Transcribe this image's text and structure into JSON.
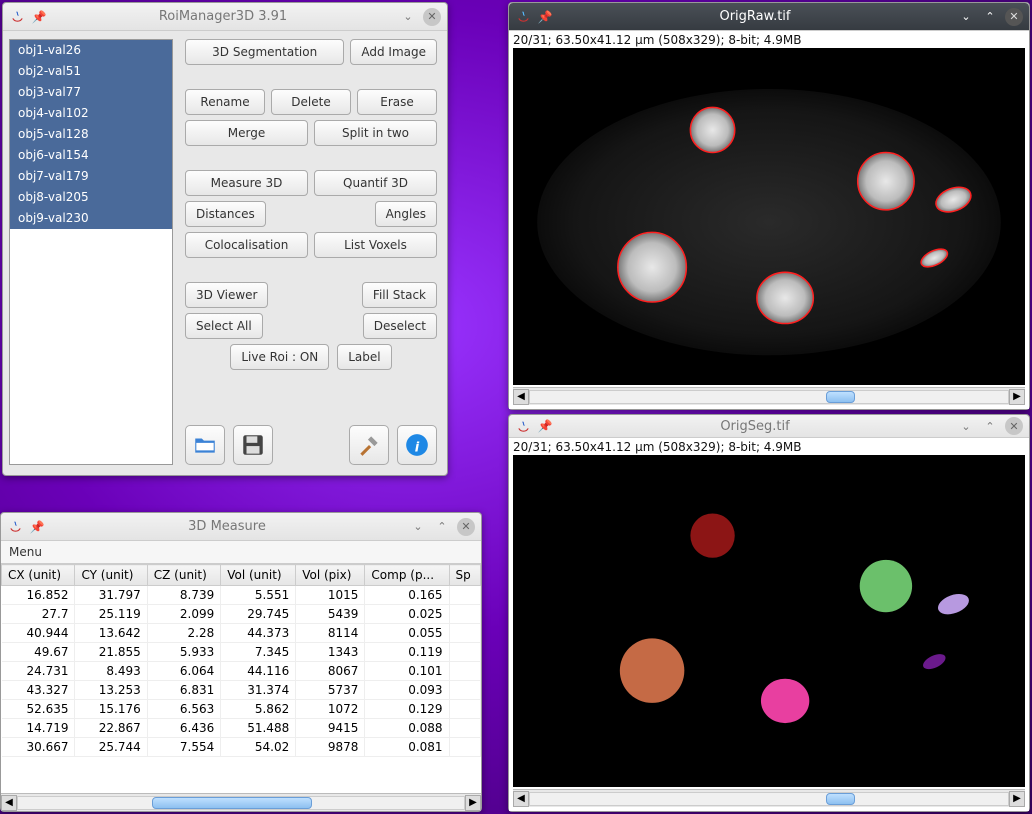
{
  "roi_window": {
    "title": "RoiManager3D 3.91",
    "objects": [
      "obj1-val26",
      "obj2-val51",
      "obj3-val77",
      "obj4-val102",
      "obj5-val128",
      "obj6-val154",
      "obj7-val179",
      "obj8-val205",
      "obj9-val230"
    ],
    "buttons": {
      "segmentation": "3D Segmentation",
      "add_image": "Add Image",
      "rename": "Rename",
      "delete": "Delete",
      "erase": "Erase",
      "merge": "Merge",
      "split": "Split in two",
      "measure3d": "Measure 3D",
      "quantif3d": "Quantif 3D",
      "distances": "Distances",
      "angles": "Angles",
      "coloc": "Colocalisation",
      "list_voxels": "List Voxels",
      "viewer3d": "3D Viewer",
      "fill_stack": "Fill Stack",
      "select_all": "Select All",
      "deselect": "Deselect",
      "live_roi": "Live Roi : ON",
      "label": "Label"
    }
  },
  "measure_window": {
    "title": "3D Measure",
    "menu": "Menu",
    "columns": [
      "CX (unit)",
      "CY (unit)",
      "CZ (unit)",
      "Vol (unit)",
      "Vol (pix)",
      "Comp (p...",
      "Sp"
    ],
    "rows": [
      [
        "16.852",
        "31.797",
        "8.739",
        "5.551",
        "1015",
        "0.165",
        ""
      ],
      [
        "27.7",
        "25.119",
        "2.099",
        "29.745",
        "5439",
        "0.025",
        ""
      ],
      [
        "40.944",
        "13.642",
        "2.28",
        "44.373",
        "8114",
        "0.055",
        ""
      ],
      [
        "49.67",
        "21.855",
        "5.933",
        "7.345",
        "1343",
        "0.119",
        ""
      ],
      [
        "24.731",
        "8.493",
        "6.064",
        "44.116",
        "8067",
        "0.101",
        ""
      ],
      [
        "43.327",
        "13.253",
        "6.831",
        "31.374",
        "5737",
        "0.093",
        ""
      ],
      [
        "52.635",
        "15.176",
        "6.563",
        "5.862",
        "1072",
        "0.129",
        ""
      ],
      [
        "14.719",
        "22.867",
        "6.436",
        "51.488",
        "9415",
        "0.088",
        ""
      ],
      [
        "30.667",
        "25.744",
        "7.554",
        "54.02",
        "9878",
        "0.081",
        ""
      ]
    ]
  },
  "origraw_window": {
    "title": "OrigRaw.tif",
    "info": "20/31; 63.50x41.12 µm (508x329); 8-bit; 4.9MB"
  },
  "origseg_window": {
    "title": "OrigSeg.tif",
    "info": "20/31; 63.50x41.12 µm (508x329); 8-bit; 4.9MB"
  },
  "icons": {
    "minimize": "⌄",
    "maximize": "⌃",
    "close": "✕",
    "pin": "📌",
    "scroll_left": "◀",
    "scroll_right": "▶"
  },
  "chart_data": {
    "type": "table",
    "title": "3D Measure",
    "columns": [
      "CX (unit)",
      "CY (unit)",
      "CZ (unit)",
      "Vol (unit)",
      "Vol (pix)",
      "Comp (pix)"
    ],
    "rows": [
      [
        16.852,
        31.797,
        8.739,
        5.551,
        1015,
        0.165
      ],
      [
        27.7,
        25.119,
        2.099,
        29.745,
        5439,
        0.025
      ],
      [
        40.944,
        13.642,
        2.28,
        44.373,
        8114,
        0.055
      ],
      [
        49.67,
        21.855,
        5.933,
        7.345,
        1343,
        0.119
      ],
      [
        24.731,
        8.493,
        6.064,
        44.116,
        8067,
        0.101
      ],
      [
        43.327,
        13.253,
        6.831,
        31.374,
        5737,
        0.093
      ],
      [
        52.635,
        15.176,
        6.563,
        5.862,
        1072,
        0.129
      ],
      [
        14.719,
        22.867,
        6.436,
        51.488,
        9415,
        0.088
      ],
      [
        30.667,
        25.744,
        7.554,
        54.02,
        9878,
        0.081
      ]
    ]
  }
}
